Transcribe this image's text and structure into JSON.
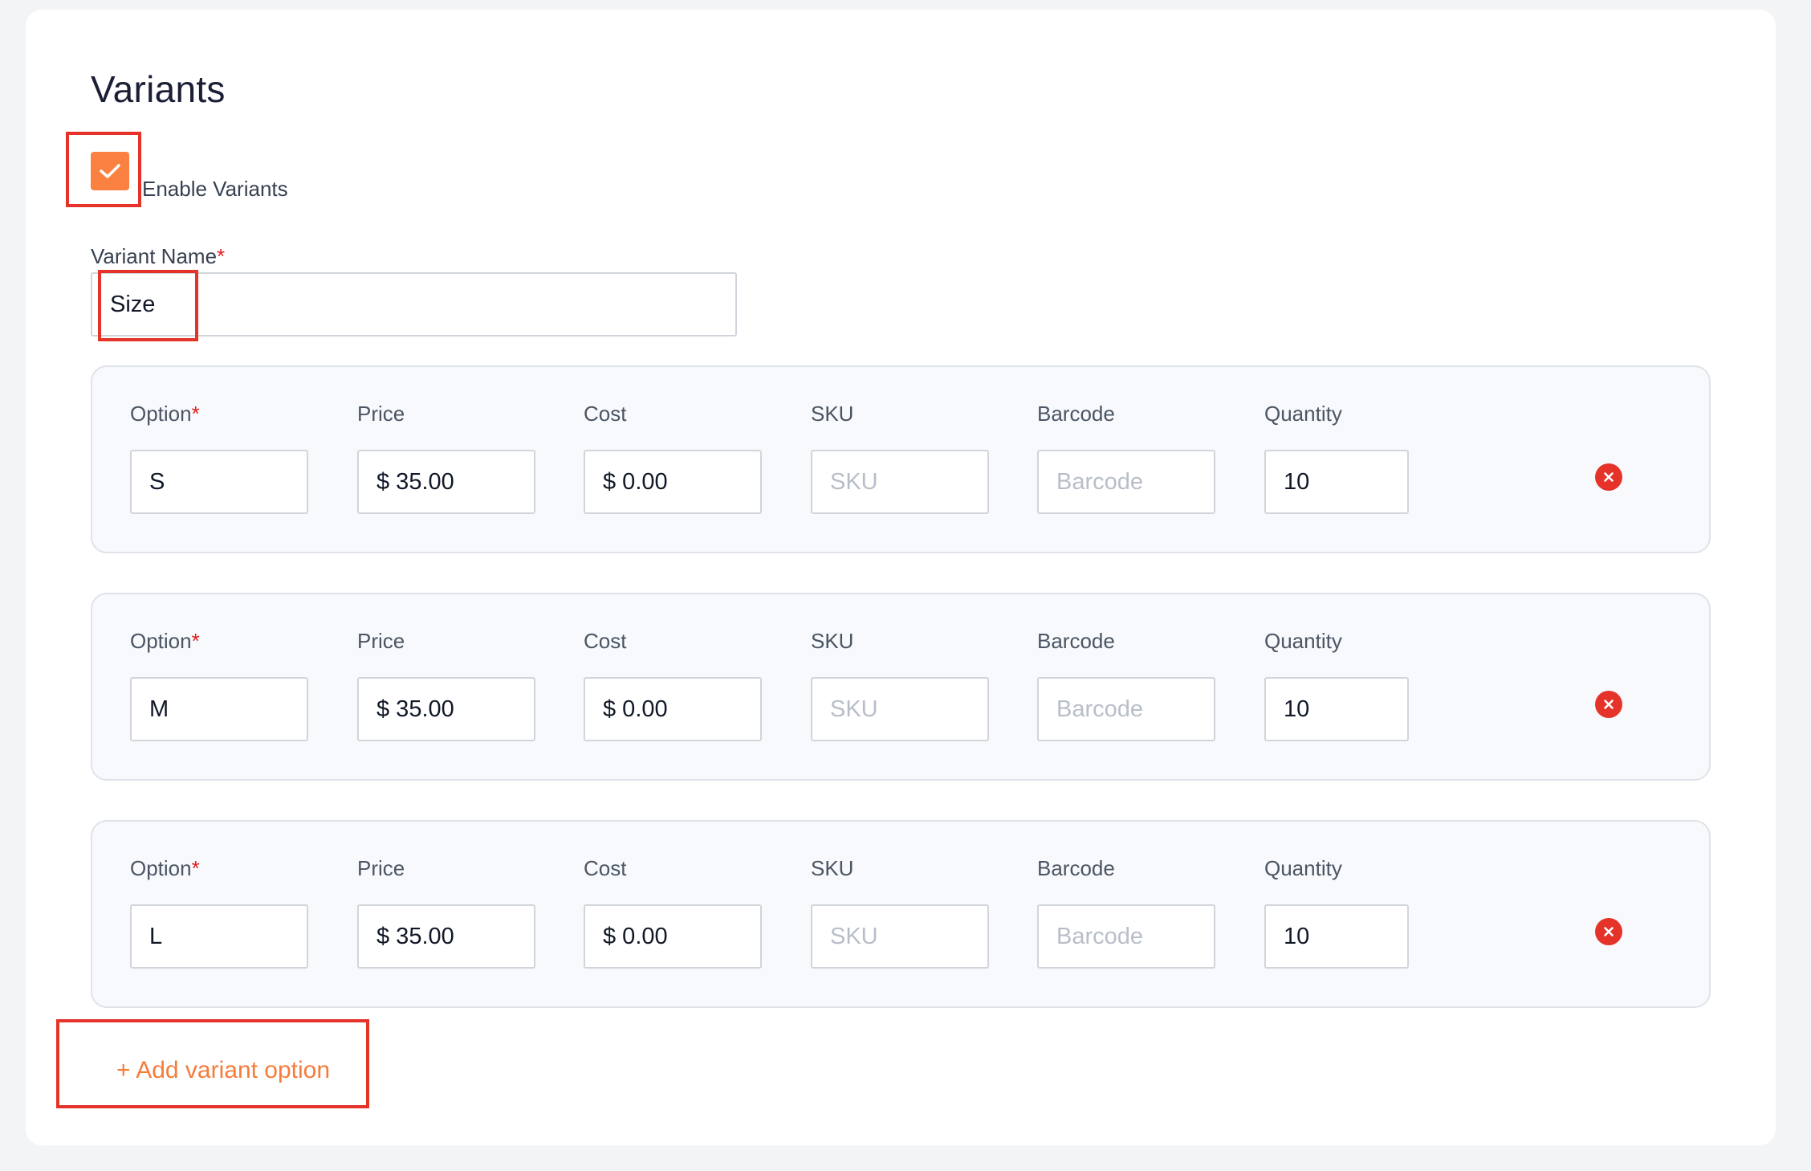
{
  "section": {
    "title": "Variants"
  },
  "enable_variants": {
    "label": "Enable Variants",
    "checked": true
  },
  "variant_name": {
    "label": "Variant Name",
    "required_mark": "*",
    "value": "Size"
  },
  "columns": {
    "option": "Option",
    "price": "Price",
    "cost": "Cost",
    "sku": "SKU",
    "barcode": "Barcode",
    "quantity": "Quantity"
  },
  "placeholders": {
    "sku": "SKU",
    "barcode": "Barcode"
  },
  "variants": [
    {
      "option": "S",
      "price": "$ 35.00",
      "cost": "$ 0.00",
      "sku": "",
      "barcode": "",
      "quantity": "10"
    },
    {
      "option": "M",
      "price": "$ 35.00",
      "cost": "$ 0.00",
      "sku": "",
      "barcode": "",
      "quantity": "10"
    },
    {
      "option": "L",
      "price": "$ 35.00",
      "cost": "$ 0.00",
      "sku": "",
      "barcode": "",
      "quantity": "10"
    }
  ],
  "add_option": {
    "label": "+ Add variant option"
  },
  "icons": {
    "checkbox": "check-icon",
    "remove": "close-circle-icon"
  },
  "colors": {
    "accent": "#fb8140",
    "link": "#f57c3a",
    "danger": "#e5332a",
    "required": "#e11d1d",
    "highlight": "#e5332a"
  }
}
